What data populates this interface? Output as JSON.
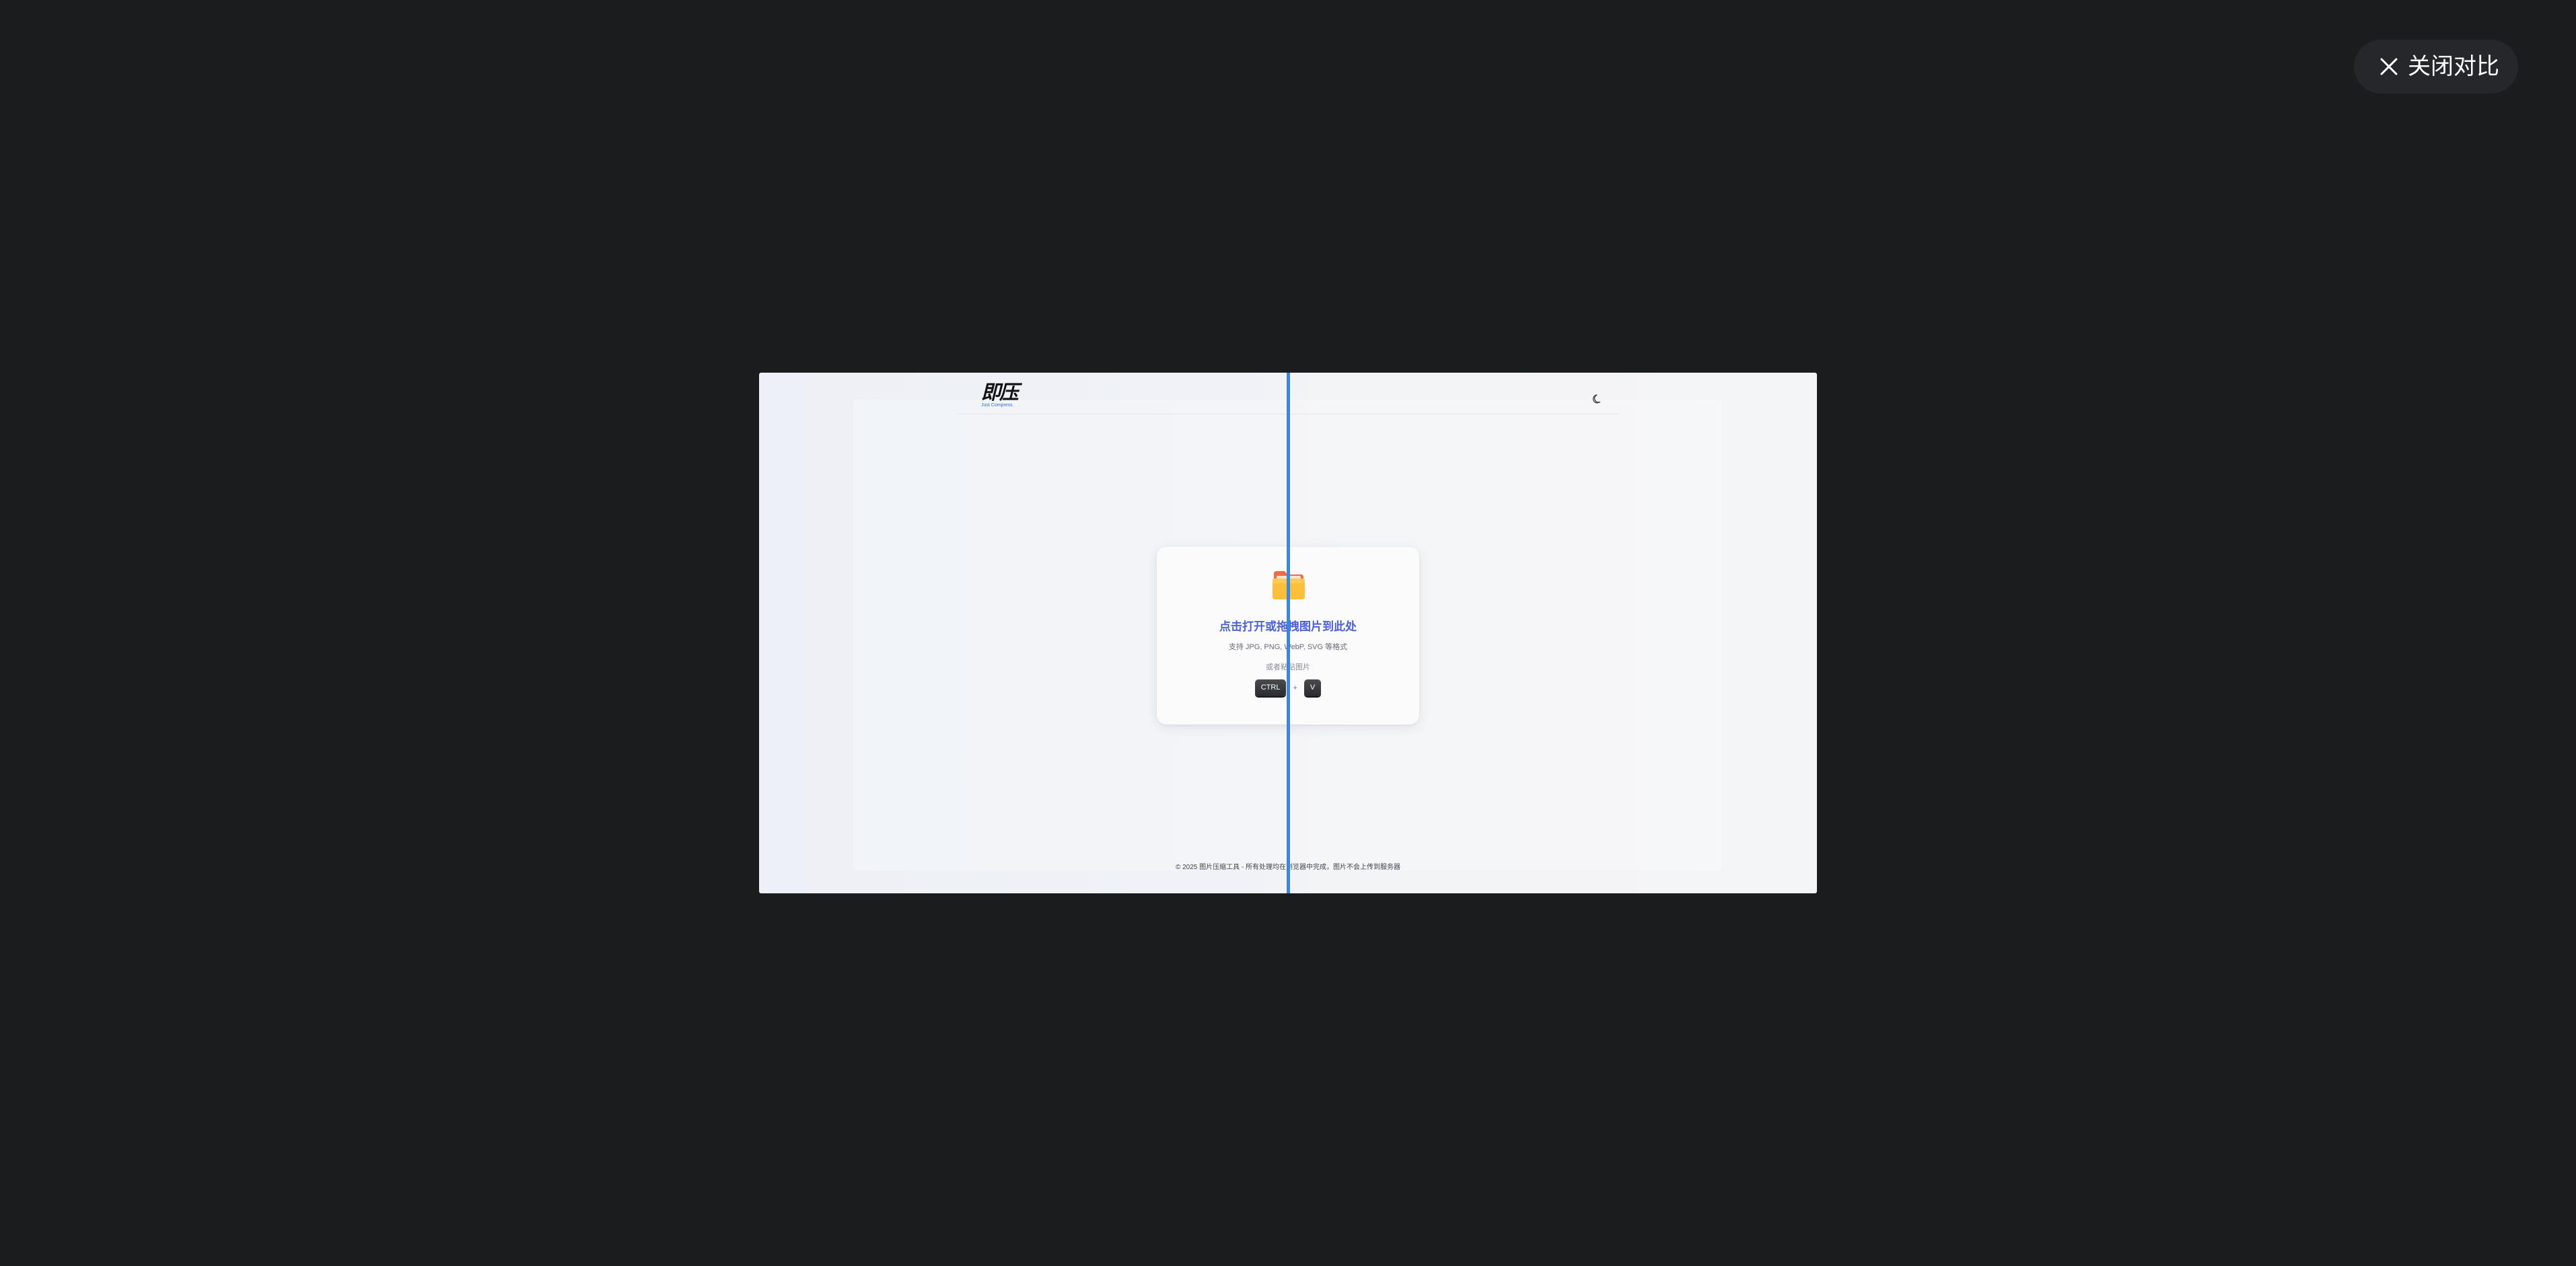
{
  "close_compare": {
    "label": "关闭对比",
    "icon": "close-icon"
  },
  "preview": {
    "logo": {
      "text": "即压",
      "subtitle": "Just Compress"
    },
    "theme_toggle": {
      "icon": "moon-icon"
    },
    "upload_card": {
      "icon": "folder-icon",
      "title": "点击打开或拖拽图片到此处",
      "formats": "支持 JPG, PNG, WebP, SVG 等格式",
      "paste_hint": "或者粘贴图片",
      "keys": [
        "CTRL",
        "+",
        "V"
      ]
    },
    "footer": "© 2025 图片压缩工具 - 所有处理均在浏览器中完成，图片不会上传到服务器"
  },
  "compare_slider": {
    "split_fraction": 0.5
  },
  "colors": {
    "app_background": "#1b1c1e",
    "close_button_bg": "#26272a",
    "accent_blue": "#4b5fd6",
    "divider": "#3a88da",
    "folder_front": "#fbbf3b",
    "folder_back": "#ef6a47"
  }
}
